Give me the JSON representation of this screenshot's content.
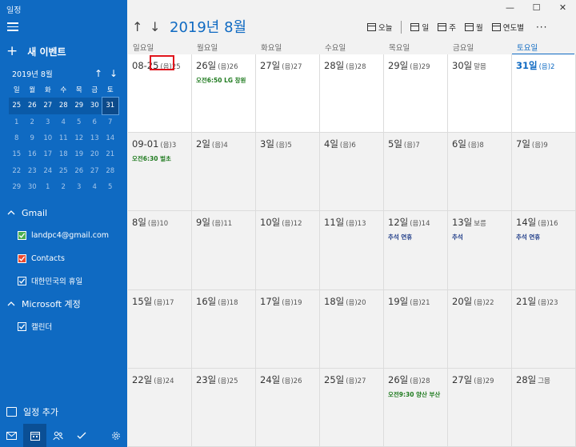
{
  "app": {
    "title": "일정"
  },
  "sidebar": {
    "new_event": "새 이벤트",
    "mini_calendar": {
      "title": "2019년 8월",
      "weekdays": [
        "일",
        "월",
        "화",
        "수",
        "목",
        "금",
        "토"
      ],
      "days": [
        {
          "d": "25",
          "cur": true
        },
        {
          "d": "26",
          "cur": true
        },
        {
          "d": "27",
          "cur": true
        },
        {
          "d": "28",
          "cur": true
        },
        {
          "d": "29",
          "cur": true
        },
        {
          "d": "30",
          "cur": true
        },
        {
          "d": "31",
          "cur": true,
          "today": true
        },
        {
          "d": "1"
        },
        {
          "d": "2"
        },
        {
          "d": "3"
        },
        {
          "d": "4"
        },
        {
          "d": "5"
        },
        {
          "d": "6"
        },
        {
          "d": "7"
        },
        {
          "d": "8"
        },
        {
          "d": "9"
        },
        {
          "d": "10"
        },
        {
          "d": "11"
        },
        {
          "d": "12"
        },
        {
          "d": "13"
        },
        {
          "d": "14"
        },
        {
          "d": "15"
        },
        {
          "d": "16"
        },
        {
          "d": "17"
        },
        {
          "d": "18"
        },
        {
          "d": "19"
        },
        {
          "d": "20"
        },
        {
          "d": "21"
        },
        {
          "d": "22"
        },
        {
          "d": "23"
        },
        {
          "d": "24"
        },
        {
          "d": "25"
        },
        {
          "d": "26"
        },
        {
          "d": "27"
        },
        {
          "d": "28"
        },
        {
          "d": "29"
        },
        {
          "d": "30"
        },
        {
          "d": "1"
        },
        {
          "d": "2"
        },
        {
          "d": "3"
        },
        {
          "d": "4"
        },
        {
          "d": "5"
        }
      ]
    },
    "gmail_header": "Gmail",
    "gmail_calendars": [
      {
        "label": "landpc4@gmail.com",
        "color": "#4caf50"
      },
      {
        "label": "Contacts",
        "color": "#e8492f"
      },
      {
        "label": "대한민국의 휴일",
        "color": "#0f6ac2"
      }
    ],
    "microsoft_header": "Microsoft 계정",
    "microsoft_calendars": [
      {
        "label": "캘린더",
        "color": "#0f6ac2"
      }
    ],
    "add_calendar": "일정 추가"
  },
  "header": {
    "month_title": "2019년 8월",
    "toolbar": {
      "today": "오늘",
      "day": "일",
      "week": "주",
      "month": "월",
      "year": "연도별"
    }
  },
  "dow": [
    "일요일",
    "월요일",
    "화요일",
    "수요일",
    "목요일",
    "금요일",
    "토요일"
  ],
  "weeks": [
    [
      {
        "date": "08-25",
        "lunar": "(음)25"
      },
      {
        "date": "26일",
        "lunar": "(음)26",
        "events": [
          {
            "text": "오전6:50 LG 창원",
            "color": "green"
          }
        ]
      },
      {
        "date": "27일",
        "lunar": "(음)27"
      },
      {
        "date": "28일",
        "lunar": "(음)28"
      },
      {
        "date": "29일",
        "lunar": "(음)29"
      },
      {
        "date": "30일",
        "lunar": "말믐"
      },
      {
        "date": "31일",
        "lunar": "(음)2",
        "today": true
      }
    ],
    [
      {
        "date": "09-01",
        "lunar": "(음)3",
        "events": [
          {
            "text": "오전6:30 벌초",
            "color": "green"
          }
        ]
      },
      {
        "date": "2일",
        "lunar": "(음)4"
      },
      {
        "date": "3일",
        "lunar": "(음)5"
      },
      {
        "date": "4일",
        "lunar": "(음)6"
      },
      {
        "date": "5일",
        "lunar": "(음)7"
      },
      {
        "date": "6일",
        "lunar": "(음)8"
      },
      {
        "date": "7일",
        "lunar": "(음)9"
      }
    ],
    [
      {
        "date": "8일",
        "lunar": "(음)10"
      },
      {
        "date": "9일",
        "lunar": "(음)11"
      },
      {
        "date": "10일",
        "lunar": "(음)12"
      },
      {
        "date": "11일",
        "lunar": "(음)13"
      },
      {
        "date": "12일",
        "lunar": "(음)14",
        "events": [
          {
            "text": "추석 연휴",
            "color": "navy"
          }
        ]
      },
      {
        "date": "13일",
        "lunar": "보름",
        "events": [
          {
            "text": "추석",
            "color": "navy"
          }
        ]
      },
      {
        "date": "14일",
        "lunar": "(음)16",
        "events": [
          {
            "text": "추석 연휴",
            "color": "navy"
          }
        ]
      }
    ],
    [
      {
        "date": "15일",
        "lunar": "(음)17"
      },
      {
        "date": "16일",
        "lunar": "(음)18"
      },
      {
        "date": "17일",
        "lunar": "(음)19"
      },
      {
        "date": "18일",
        "lunar": "(음)20"
      },
      {
        "date": "19일",
        "lunar": "(음)21"
      },
      {
        "date": "20일",
        "lunar": "(음)22"
      },
      {
        "date": "21일",
        "lunar": "(음)23"
      }
    ],
    [
      {
        "date": "22일",
        "lunar": "(음)24"
      },
      {
        "date": "23일",
        "lunar": "(음)25"
      },
      {
        "date": "24일",
        "lunar": "(음)26"
      },
      {
        "date": "25일",
        "lunar": "(음)27"
      },
      {
        "date": "26일",
        "lunar": "(음)28",
        "events": [
          {
            "text": "오전9:30 양산 부산",
            "color": "green"
          }
        ]
      },
      {
        "date": "27일",
        "lunar": "(음)29"
      },
      {
        "date": "28일",
        "lunar": "그믐"
      }
    ]
  ]
}
